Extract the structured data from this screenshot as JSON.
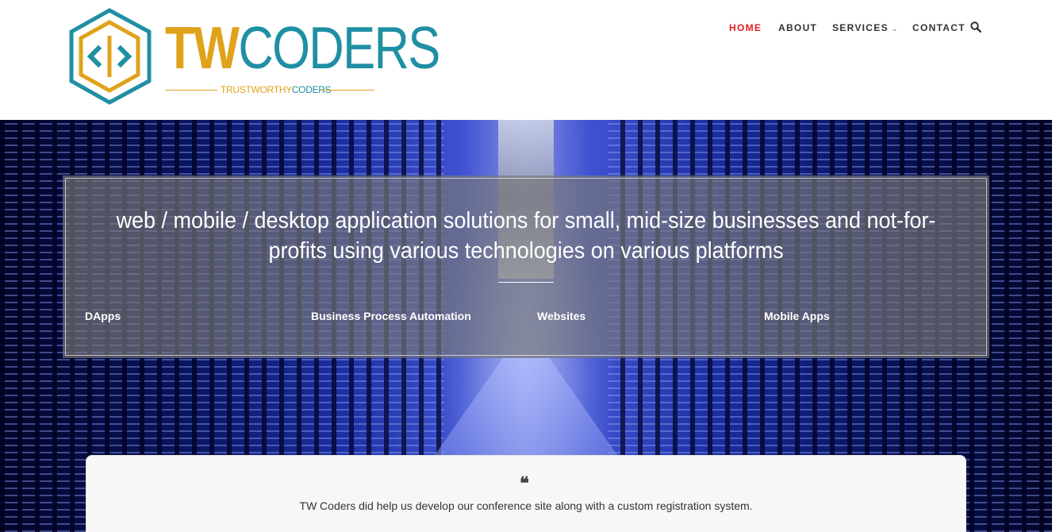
{
  "logo": {
    "word_tw": "TW",
    "word_coders": "CODERS",
    "tagline_part1": "TRUSTWORTHY",
    "tagline_part2": "CODERS",
    "colors": {
      "gold": "#e0a21a",
      "teal": "#1f8fa3"
    }
  },
  "nav": {
    "items": [
      {
        "label": "HOME",
        "active": true
      },
      {
        "label": "ABOUT",
        "active": false
      },
      {
        "label": "SERVICES",
        "active": false,
        "has_dropdown": true
      },
      {
        "label": "CONTACT",
        "active": false
      }
    ],
    "search_icon": "search-icon",
    "active_color": "#e41f1f"
  },
  "hero": {
    "headline": "web / mobile / desktop application solutions for small, mid-size businesses and not-for-profits using various technologies on various platforms",
    "services": [
      "DApps",
      "Business Process Automation",
      "Websites",
      "Mobile Apps"
    ]
  },
  "testimonial": {
    "icon": "quote-icon",
    "quote_mark": "❝",
    "text": "TW Coders did help us develop our conference site along with a custom registration system."
  }
}
